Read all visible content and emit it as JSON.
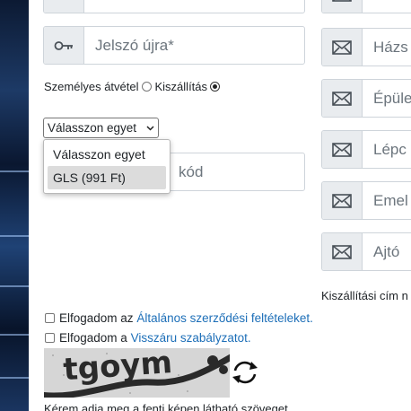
{
  "left_fields": {
    "password_confirm_placeholder": "Jelszó újra*",
    "zip_placeholder": "kód"
  },
  "delivery": {
    "personal_pickup_label": "Személyes átvétel",
    "shipping_label": "Kiszállítás",
    "selected": "Kiszállítás"
  },
  "shipping_select": {
    "selected_value": "Válasszon egyet",
    "options": [
      "Válasszon egyet",
      "GLS (991 Ft)"
    ],
    "highlighted": "GLS (991 Ft)"
  },
  "right_fields": {
    "house_placeholder": "Házs",
    "building_placeholder": "Épüle",
    "stairs_placeholder": "Lépc",
    "floor_placeholder": "Emel",
    "door_placeholder": "Ajtó"
  },
  "shipping_address_note": "Kiszállítási cím n",
  "terms": {
    "accept_prefix": "Elfogadom az",
    "terms_link": "Általános szerződési feltételeket.",
    "return_prefix": "Elfogadom a",
    "return_link": "Visszáru szabályzatot."
  },
  "captcha": {
    "text": "tgoym",
    "instruction": "Kérem adja meg a fenti képen látható szöveget"
  },
  "icons": {
    "key": "key-icon",
    "envelope": "envelope-icon",
    "refresh": "refresh-icon"
  },
  "colors": {
    "link": "#1d6fb8",
    "addon_bg": "#e9ecef",
    "border": "#ced4da"
  }
}
